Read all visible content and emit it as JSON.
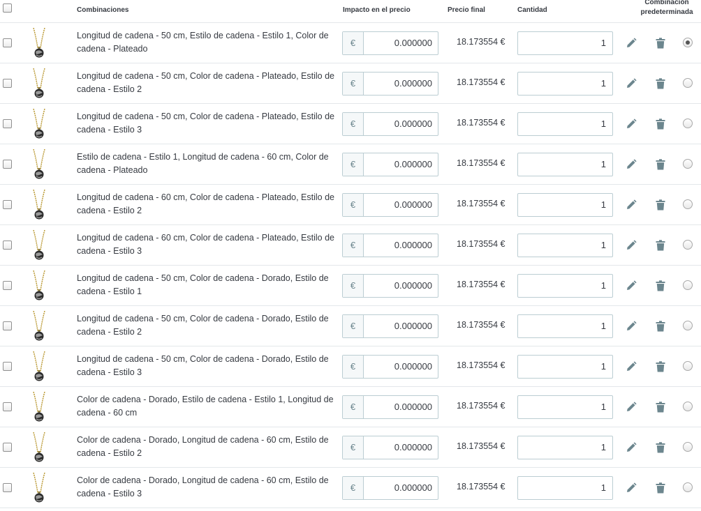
{
  "header": {
    "combinations": "Combinaciones",
    "price_impact": "Impacto en el precio",
    "final_price": "Precio final",
    "quantity": "Cantidad",
    "default_line1": "Combinación",
    "default_line2": "predeterminada"
  },
  "currency_symbol": "€",
  "rows": [
    {
      "name": "Longitud de cadena - 50 cm, Estilo de cadena - Estilo 1, Color de cadena - Plateado",
      "impact": "0.000000",
      "final": "18.173554 €",
      "qty": "1",
      "default": true
    },
    {
      "name": "Longitud de cadena - 50 cm, Color de cadena - Plateado, Estilo de cadena - Estilo 2",
      "impact": "0.000000",
      "final": "18.173554 €",
      "qty": "1",
      "default": false
    },
    {
      "name": "Longitud de cadena - 50 cm, Color de cadena - Plateado, Estilo de cadena - Estilo 3",
      "impact": "0.000000",
      "final": "18.173554 €",
      "qty": "1",
      "default": false
    },
    {
      "name": "Estilo de cadena - Estilo 1, Longitud de cadena - 60 cm, Color de cadena - Plateado",
      "impact": "0.000000",
      "final": "18.173554 €",
      "qty": "1",
      "default": false
    },
    {
      "name": "Longitud de cadena - 60 cm, Color de cadena - Plateado, Estilo de cadena - Estilo 2",
      "impact": "0.000000",
      "final": "18.173554 €",
      "qty": "1",
      "default": false
    },
    {
      "name": "Longitud de cadena - 60 cm, Color de cadena - Plateado, Estilo de cadena - Estilo 3",
      "impact": "0.000000",
      "final": "18.173554 €",
      "qty": "1",
      "default": false
    },
    {
      "name": "Longitud de cadena - 50 cm, Color de cadena - Dorado, Estilo de cadena - Estilo 1",
      "impact": "0.000000",
      "final": "18.173554 €",
      "qty": "1",
      "default": false
    },
    {
      "name": "Longitud de cadena - 50 cm, Color de cadena - Dorado, Estilo de cadena - Estilo 2",
      "impact": "0.000000",
      "final": "18.173554 €",
      "qty": "1",
      "default": false
    },
    {
      "name": "Longitud de cadena - 50 cm, Color de cadena - Dorado, Estilo de cadena - Estilo 3",
      "impact": "0.000000",
      "final": "18.173554 €",
      "qty": "1",
      "default": false
    },
    {
      "name": "Color de cadena - Dorado, Estilo de cadena - Estilo 1, Longitud de cadena - 60 cm",
      "impact": "0.000000",
      "final": "18.173554 €",
      "qty": "1",
      "default": false
    },
    {
      "name": "Color de cadena - Dorado, Longitud de cadena - 60 cm, Estilo de cadena - Estilo 2",
      "impact": "0.000000",
      "final": "18.173554 €",
      "qty": "1",
      "default": false
    },
    {
      "name": "Color de cadena - Dorado, Longitud de cadena - 60 cm, Estilo de cadena - Estilo 3",
      "impact": "0.000000",
      "final": "18.173554 €",
      "qty": "1",
      "default": false
    }
  ],
  "icons": {
    "row_select": "checkbox-icon",
    "thumbnail": "necklace-thumbnail-icon",
    "edit": "pencil-icon",
    "delete": "trash-icon",
    "default": "radio-icon"
  },
  "colors": {
    "border": "#bbcdd2",
    "icon": "#6c868e",
    "text": "#363a41"
  }
}
